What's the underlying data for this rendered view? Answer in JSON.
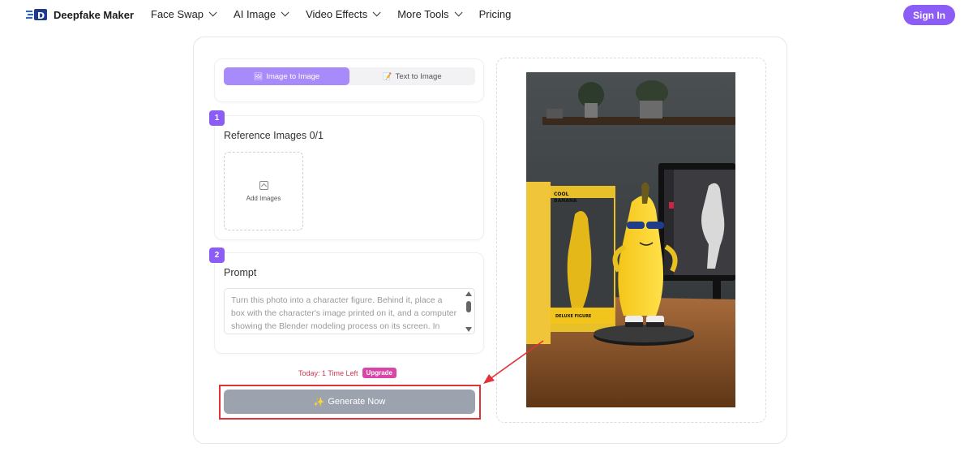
{
  "nav": {
    "brand": "Deepfake Maker",
    "items": [
      {
        "label": "Face Swap",
        "dropdown": true
      },
      {
        "label": "AI Image",
        "dropdown": true
      },
      {
        "label": "Video Effects",
        "dropdown": true
      },
      {
        "label": "More Tools",
        "dropdown": true
      },
      {
        "label": "Pricing",
        "dropdown": false
      }
    ],
    "sign_in": "Sign In"
  },
  "tabs": {
    "image_to_image": "Image to Image",
    "text_to_image": "Text to Image",
    "active": "image_to_image"
  },
  "step1": {
    "number": "1",
    "title": "Reference Images 0/1",
    "upload_label": "Add Images"
  },
  "step2": {
    "number": "2",
    "title": "Prompt",
    "prompt_value": "Turn this photo into a character figure. Behind it, place a box with the character's image printed on it, and a computer showing the Blender modeling process on its screen. In front of the box, add a round plastic base with"
  },
  "usage": {
    "text": "Today: 1 Time Left",
    "upgrade": "Upgrade"
  },
  "generate": {
    "label": "Generate Now"
  },
  "preview_box": {
    "title_line1": "COOL",
    "title_line2": "BANANA",
    "front_label": "DELUXE FIGURE"
  },
  "colors": {
    "accent": "#8b5cf6",
    "tab_active": "#a78bfa",
    "button_disabled": "#9ca3af",
    "highlight": "#e0333a",
    "upgrade_badge": "#d946a8"
  }
}
